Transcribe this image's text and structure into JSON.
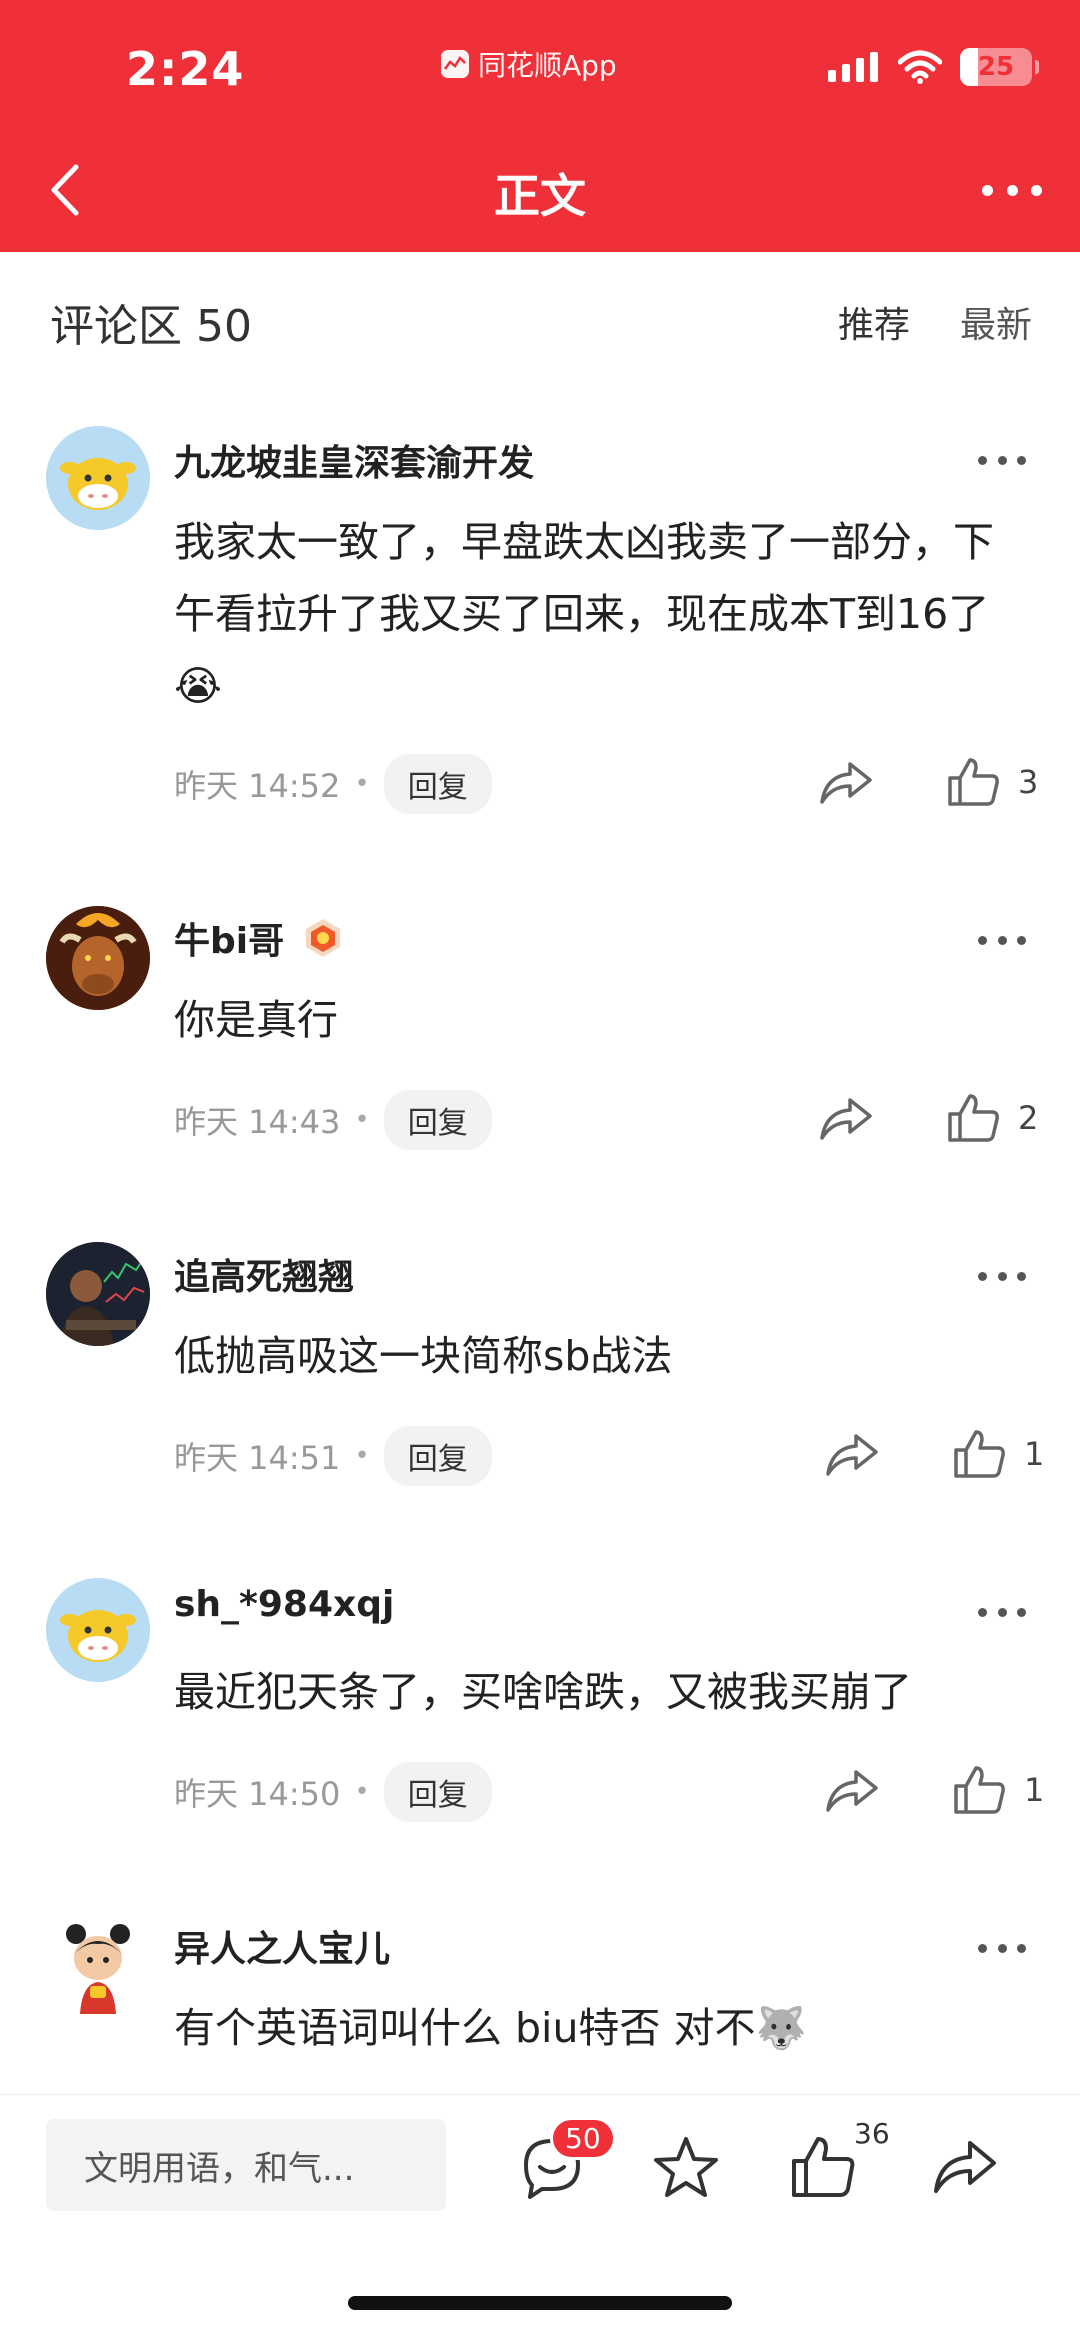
{
  "status_bar": {
    "time": "2:24",
    "app_label": "同花顺App",
    "battery": "25",
    "battery_level": 0.25
  },
  "nav": {
    "title": "正文"
  },
  "comments_header": {
    "title": "评论区 50",
    "tab_recommend": "推荐",
    "tab_latest": "最新"
  },
  "comments": [
    {
      "username": "九龙坡韭皇深套渝开发",
      "text": "我家太一致了，早盘跌太凶我卖了一部分，下午看拉升了我又买了回来，现在成本T到16了",
      "emoji": "😭",
      "time": "昨天 14:52",
      "reply_label": "回复",
      "likes": "3",
      "avatar": "cow-avatar"
    },
    {
      "username": "牛bi哥",
      "text": "你是真行",
      "time": "昨天 14:43",
      "reply_label": "回复",
      "likes": "2",
      "avatar": "bull-avatar"
    },
    {
      "username": "追高死翘翘",
      "text": "低抛高吸这一块简称sb战法",
      "time": "昨天 14:51",
      "reply_label": "回复",
      "likes": "1",
      "avatar": "trader-avatar"
    },
    {
      "username": "sh_*984xqj",
      "text": "最近犯天条了，买啥啥跌，又被我买崩了",
      "time": "昨天 14:50",
      "reply_label": "回复",
      "likes": "1",
      "avatar": "cow-avatar"
    },
    {
      "username": "异人之人宝儿",
      "text": "有个英语词叫什么 biu特否 对不",
      "emoji": "🐺",
      "avatar": "girl-avatar"
    }
  ],
  "bottom_bar": {
    "input_placeholder": "文明用语，和气...",
    "comment_count": "50",
    "like_count": "36"
  },
  "colors": {
    "brand_red": "#f03039",
    "text_primary": "#222222",
    "text_secondary": "#999999"
  }
}
